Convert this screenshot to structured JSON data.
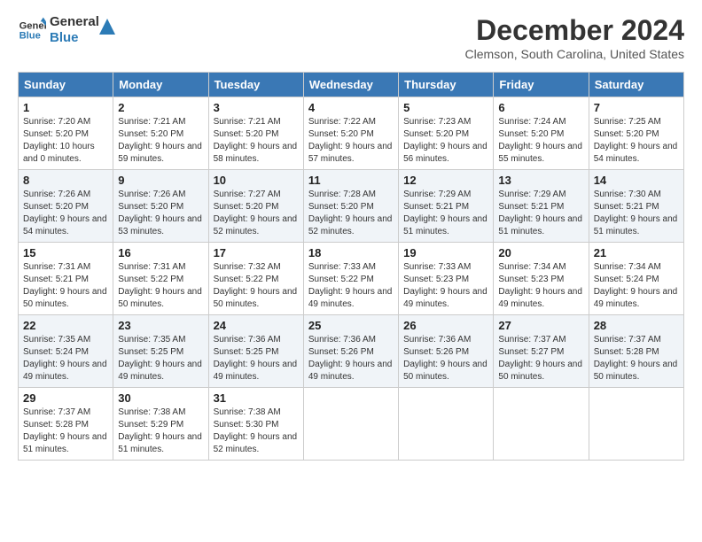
{
  "logo": {
    "line1": "General",
    "line2": "Blue"
  },
  "title": "December 2024",
  "subtitle": "Clemson, South Carolina, United States",
  "days_of_week": [
    "Sunday",
    "Monday",
    "Tuesday",
    "Wednesday",
    "Thursday",
    "Friday",
    "Saturday"
  ],
  "weeks": [
    [
      {
        "day": "1",
        "sunrise": "7:20 AM",
        "sunset": "5:20 PM",
        "daylight": "10 hours and 0 minutes."
      },
      {
        "day": "2",
        "sunrise": "7:21 AM",
        "sunset": "5:20 PM",
        "daylight": "9 hours and 59 minutes."
      },
      {
        "day": "3",
        "sunrise": "7:21 AM",
        "sunset": "5:20 PM",
        "daylight": "9 hours and 58 minutes."
      },
      {
        "day": "4",
        "sunrise": "7:22 AM",
        "sunset": "5:20 PM",
        "daylight": "9 hours and 57 minutes."
      },
      {
        "day": "5",
        "sunrise": "7:23 AM",
        "sunset": "5:20 PM",
        "daylight": "9 hours and 56 minutes."
      },
      {
        "day": "6",
        "sunrise": "7:24 AM",
        "sunset": "5:20 PM",
        "daylight": "9 hours and 55 minutes."
      },
      {
        "day": "7",
        "sunrise": "7:25 AM",
        "sunset": "5:20 PM",
        "daylight": "9 hours and 54 minutes."
      }
    ],
    [
      {
        "day": "8",
        "sunrise": "7:26 AM",
        "sunset": "5:20 PM",
        "daylight": "9 hours and 54 minutes."
      },
      {
        "day": "9",
        "sunrise": "7:26 AM",
        "sunset": "5:20 PM",
        "daylight": "9 hours and 53 minutes."
      },
      {
        "day": "10",
        "sunrise": "7:27 AM",
        "sunset": "5:20 PM",
        "daylight": "9 hours and 52 minutes."
      },
      {
        "day": "11",
        "sunrise": "7:28 AM",
        "sunset": "5:20 PM",
        "daylight": "9 hours and 52 minutes."
      },
      {
        "day": "12",
        "sunrise": "7:29 AM",
        "sunset": "5:21 PM",
        "daylight": "9 hours and 51 minutes."
      },
      {
        "day": "13",
        "sunrise": "7:29 AM",
        "sunset": "5:21 PM",
        "daylight": "9 hours and 51 minutes."
      },
      {
        "day": "14",
        "sunrise": "7:30 AM",
        "sunset": "5:21 PM",
        "daylight": "9 hours and 51 minutes."
      }
    ],
    [
      {
        "day": "15",
        "sunrise": "7:31 AM",
        "sunset": "5:21 PM",
        "daylight": "9 hours and 50 minutes."
      },
      {
        "day": "16",
        "sunrise": "7:31 AM",
        "sunset": "5:22 PM",
        "daylight": "9 hours and 50 minutes."
      },
      {
        "day": "17",
        "sunrise": "7:32 AM",
        "sunset": "5:22 PM",
        "daylight": "9 hours and 50 minutes."
      },
      {
        "day": "18",
        "sunrise": "7:33 AM",
        "sunset": "5:22 PM",
        "daylight": "9 hours and 49 minutes."
      },
      {
        "day": "19",
        "sunrise": "7:33 AM",
        "sunset": "5:23 PM",
        "daylight": "9 hours and 49 minutes."
      },
      {
        "day": "20",
        "sunrise": "7:34 AM",
        "sunset": "5:23 PM",
        "daylight": "9 hours and 49 minutes."
      },
      {
        "day": "21",
        "sunrise": "7:34 AM",
        "sunset": "5:24 PM",
        "daylight": "9 hours and 49 minutes."
      }
    ],
    [
      {
        "day": "22",
        "sunrise": "7:35 AM",
        "sunset": "5:24 PM",
        "daylight": "9 hours and 49 minutes."
      },
      {
        "day": "23",
        "sunrise": "7:35 AM",
        "sunset": "5:25 PM",
        "daylight": "9 hours and 49 minutes."
      },
      {
        "day": "24",
        "sunrise": "7:36 AM",
        "sunset": "5:25 PM",
        "daylight": "9 hours and 49 minutes."
      },
      {
        "day": "25",
        "sunrise": "7:36 AM",
        "sunset": "5:26 PM",
        "daylight": "9 hours and 49 minutes."
      },
      {
        "day": "26",
        "sunrise": "7:36 AM",
        "sunset": "5:26 PM",
        "daylight": "9 hours and 50 minutes."
      },
      {
        "day": "27",
        "sunrise": "7:37 AM",
        "sunset": "5:27 PM",
        "daylight": "9 hours and 50 minutes."
      },
      {
        "day": "28",
        "sunrise": "7:37 AM",
        "sunset": "5:28 PM",
        "daylight": "9 hours and 50 minutes."
      }
    ],
    [
      {
        "day": "29",
        "sunrise": "7:37 AM",
        "sunset": "5:28 PM",
        "daylight": "9 hours and 51 minutes."
      },
      {
        "day": "30",
        "sunrise": "7:38 AM",
        "sunset": "5:29 PM",
        "daylight": "9 hours and 51 minutes."
      },
      {
        "day": "31",
        "sunrise": "7:38 AM",
        "sunset": "5:30 PM",
        "daylight": "9 hours and 52 minutes."
      },
      null,
      null,
      null,
      null
    ]
  ]
}
